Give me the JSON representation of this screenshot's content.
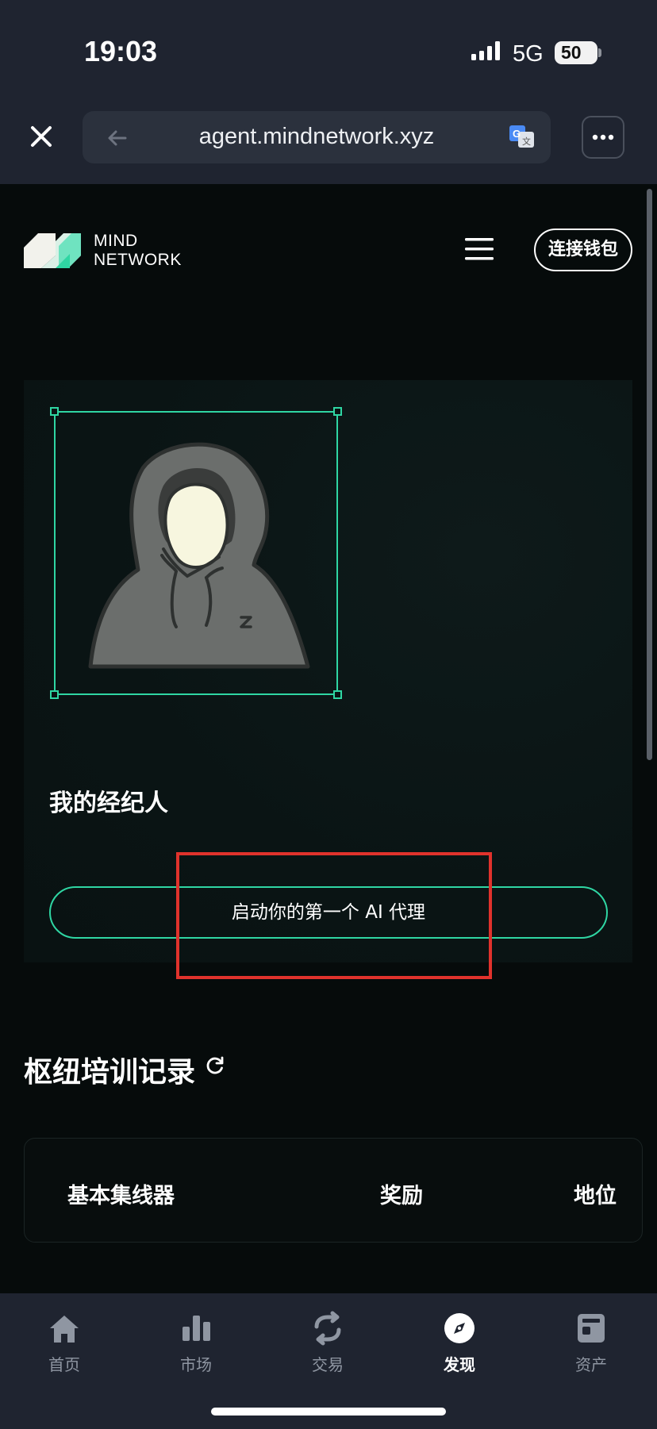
{
  "status_bar": {
    "time": "19:03",
    "network": "5G",
    "battery": "50",
    "icons": [
      "signal-icon",
      "battery-icon"
    ]
  },
  "browser": {
    "url": "agent.mindnetwork.xyz",
    "icons": [
      "close-icon",
      "back-arrow-icon",
      "translate-icon",
      "more-icon"
    ]
  },
  "header": {
    "logo_line1": "MIND",
    "logo_line2": "NETWORK",
    "menu_icon": "hamburger-menu-icon",
    "connect_wallet": "连接钱包"
  },
  "agent_card": {
    "avatar_icon": "hooded-figure-avatar",
    "title": "我的经纪人",
    "launch_button": "启动你的第一个 AI 代理",
    "accent_color": "#2fd6a3",
    "highlight_color": "#e0322c"
  },
  "training": {
    "title": "枢纽培训记录",
    "refresh_icon": "refresh-icon",
    "columns": [
      "基本集线器",
      "奖励",
      "地位"
    ]
  },
  "tabbar": {
    "items": [
      {
        "label": "首页",
        "icon": "home-icon",
        "active": false
      },
      {
        "label": "市场",
        "icon": "bar-chart-icon",
        "active": false
      },
      {
        "label": "交易",
        "icon": "swap-icon",
        "active": false
      },
      {
        "label": "发现",
        "icon": "compass-icon",
        "active": true
      },
      {
        "label": "资产",
        "icon": "wallet-icon",
        "active": false
      }
    ]
  }
}
